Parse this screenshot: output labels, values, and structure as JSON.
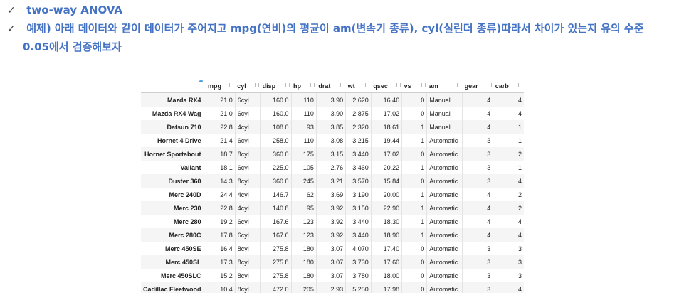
{
  "bullets": {
    "check_glyph": "✓",
    "line1": "two-way ANOVA",
    "line2": "예제) 아래 데이터와 같이 데이터가 주어지고 mpg(연비)의 평균이 am(변속기 종류),  cyl(실린더 종류)따라서 차이가 있는지 유의 수준",
    "line2_cont": "0.05에서 검증해보자"
  },
  "colors": {
    "accent": "#4472c4",
    "header_dot": "#4da3e0"
  },
  "table": {
    "columns": [
      "mpg",
      "cyl",
      "disp",
      "hp",
      "drat",
      "wt",
      "qsec",
      "vs",
      "am",
      "gear",
      "carb"
    ],
    "rows": [
      [
        "Mazda RX4",
        "21.0",
        "6cyl",
        "160.0",
        "110",
        "3.90",
        "2.620",
        "16.46",
        "0",
        "Manual",
        "4",
        "4"
      ],
      [
        "Mazda RX4 Wag",
        "21.0",
        "6cyl",
        "160.0",
        "110",
        "3.90",
        "2.875",
        "17.02",
        "0",
        "Manual",
        "4",
        "4"
      ],
      [
        "Datsun 710",
        "22.8",
        "4cyl",
        "108.0",
        "93",
        "3.85",
        "2.320",
        "18.61",
        "1",
        "Manual",
        "4",
        "1"
      ],
      [
        "Hornet 4 Drive",
        "21.4",
        "6cyl",
        "258.0",
        "110",
        "3.08",
        "3.215",
        "19.44",
        "1",
        "Automatic",
        "3",
        "1"
      ],
      [
        "Hornet Sportabout",
        "18.7",
        "8cyl",
        "360.0",
        "175",
        "3.15",
        "3.440",
        "17.02",
        "0",
        "Automatic",
        "3",
        "2"
      ],
      [
        "Valiant",
        "18.1",
        "6cyl",
        "225.0",
        "105",
        "2.76",
        "3.460",
        "20.22",
        "1",
        "Automatic",
        "3",
        "1"
      ],
      [
        "Duster 360",
        "14.3",
        "8cyl",
        "360.0",
        "245",
        "3.21",
        "3.570",
        "15.84",
        "0",
        "Automatic",
        "3",
        "4"
      ],
      [
        "Merc 240D",
        "24.4",
        "4cyl",
        "146.7",
        "62",
        "3.69",
        "3.190",
        "20.00",
        "1",
        "Automatic",
        "4",
        "2"
      ],
      [
        "Merc 230",
        "22.8",
        "4cyl",
        "140.8",
        "95",
        "3.92",
        "3.150",
        "22.90",
        "1",
        "Automatic",
        "4",
        "2"
      ],
      [
        "Merc 280",
        "19.2",
        "6cyl",
        "167.6",
        "123",
        "3.92",
        "3.440",
        "18.30",
        "1",
        "Automatic",
        "4",
        "4"
      ],
      [
        "Merc 280C",
        "17.8",
        "6cyl",
        "167.6",
        "123",
        "3.92",
        "3.440",
        "18.90",
        "1",
        "Automatic",
        "4",
        "4"
      ],
      [
        "Merc 450SE",
        "16.4",
        "8cyl",
        "275.8",
        "180",
        "3.07",
        "4.070",
        "17.40",
        "0",
        "Automatic",
        "3",
        "3"
      ],
      [
        "Merc 450SL",
        "17.3",
        "8cyl",
        "275.8",
        "180",
        "3.07",
        "3.730",
        "17.60",
        "0",
        "Automatic",
        "3",
        "3"
      ],
      [
        "Merc 450SLC",
        "15.2",
        "8cyl",
        "275.8",
        "180",
        "3.07",
        "3.780",
        "18.00",
        "0",
        "Automatic",
        "3",
        "3"
      ],
      [
        "Cadillac Fleetwood",
        "10.4",
        "8cyl",
        "472.0",
        "205",
        "2.93",
        "5.250",
        "17.98",
        "0",
        "Automatic",
        "3",
        "4"
      ]
    ]
  }
}
